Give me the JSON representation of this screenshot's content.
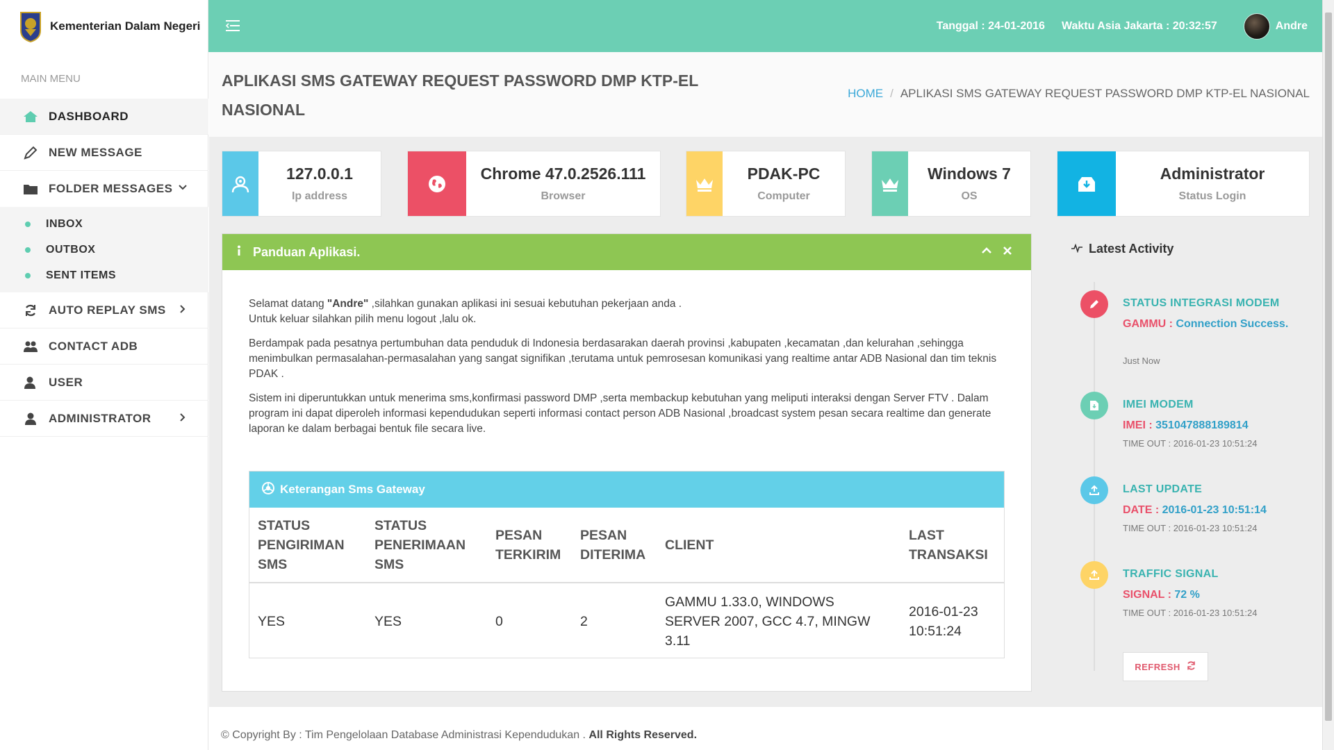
{
  "brand": {
    "name": "Kementerian Dalam Negeri"
  },
  "sidebar": {
    "caption": "MAIN MENU",
    "items": [
      {
        "label": "DASHBOARD",
        "icon": "home-icon"
      },
      {
        "label": "NEW MESSAGE",
        "icon": "pencil-icon"
      },
      {
        "label": "FOLDER MESSAGES",
        "icon": "folder-icon"
      },
      {
        "label": "AUTO REPLAY SMS",
        "icon": "refresh-icon"
      },
      {
        "label": "CONTACT ADB",
        "icon": "users-icon"
      },
      {
        "label": "USER",
        "icon": "user-icon"
      },
      {
        "label": "ADMINISTRATOR",
        "icon": "user-icon"
      }
    ],
    "sub_items": [
      {
        "label": "INBOX"
      },
      {
        "label": "OUTBOX"
      },
      {
        "label": "SENT ITEMS"
      }
    ]
  },
  "topbar": {
    "date": "Tanggal : 24-01-2016",
    "time": "Waktu Asia Jakarta : 20:32:57",
    "user": "Andre"
  },
  "page": {
    "title": "APLIKASI SMS GATEWAY REQUEST PASSWORD DMP KTP-EL NASIONAL",
    "breadcrumb_home": "HOME",
    "breadcrumb_current": "APLIKASI SMS GATEWAY REQUEST PASSWORD DMP KTP-EL NASIONAL"
  },
  "stats": [
    {
      "value": "127.0.0.1",
      "label": "Ip address",
      "color": "#5bc8e8",
      "icon": "user-search-icon"
    },
    {
      "value": "Chrome 47.0.2526.111",
      "label": "Browser",
      "color": "#ec5066",
      "icon": "globe-icon"
    },
    {
      "value": "PDAK-PC",
      "label": "Computer",
      "color": "#fed466",
      "icon": "crown-icon"
    },
    {
      "value": "Windows 7",
      "label": "OS",
      "color": "#6ccfb4",
      "icon": "crown-icon"
    },
    {
      "value": "Administrator",
      "label": "Status Login",
      "color": "#12b3e3",
      "icon": "inbox-download-icon"
    }
  ],
  "guide": {
    "title": "Panduan Aplikasi.",
    "p1a": "Selamat datang ",
    "p1_user": "\"Andre\"",
    "p1b": " ,silahkan gunakan aplikasi ini sesuai kebutuhan pekerjaan anda .",
    "p1c": "Untuk keluar silahkan pilih menu logout ,lalu ok.",
    "p2": "Berdampak pada pesatnya pertumbuhan data penduduk di Indonesia berdasarakan daerah provinsi ,kabupaten ,kecamatan ,dan kelurahan ,sehingga menimbulkan permasalahan-permasalahan yang sangat signifikan ,terutama untuk pemrosesan komunikasi yang realtime antar ADB Nasional dan tim teknis PDAK .",
    "p3": "Sistem ini diperuntukkan untuk menerima sms,konfirmasi password DMP ,serta membackup kebutuhan yang meliputi interaksi dengan Server FTV . Dalam program ini dapat diperoleh informasi kependudukan seperti informasi contact person ADB Nasional ,broadcast system pesan secara realtime dan generate laporan ke dalam berbagai bentuk file secara live."
  },
  "gateway": {
    "title": "Keterangan Sms Gateway",
    "headers": [
      "STATUS PENGIRIMAN SMS",
      "STATUS PENERIMAAN SMS",
      "PESAN TERKIRIM",
      "PESAN DITERIMA",
      "CLIENT",
      "LAST TRANSAKSI"
    ],
    "row": [
      "YES",
      "YES",
      "0",
      "2",
      "GAMMU 1.33.0, WINDOWS SERVER 2007, GCC 4.7, MINGW 3.11",
      "2016-01-23 10:51:24"
    ]
  },
  "activity": {
    "title": "Latest Activity",
    "items": [
      {
        "title": "STATUS INTEGRASI MODEM",
        "key": "GAMMU :",
        "value": "Connection Success.",
        "time": "Just Now",
        "color": "#ec5066",
        "icon": "pencil-icon"
      },
      {
        "title": "IMEI MODEM",
        "key": "IMEI :",
        "value": "351047888189814",
        "time": "TIME OUT : 2016-01-23 10:51:24",
        "color": "#6ccfb4",
        "icon": "file-icon"
      },
      {
        "title": "LAST UPDATE",
        "key": "DATE :",
        "value": "2016-01-23 10:51:14",
        "time": "TIME OUT : 2016-01-23 10:51:24",
        "color": "#5bc8e8",
        "icon": "upload-icon"
      },
      {
        "title": "TRAFFIC SIGNAL",
        "key": "SIGNAL :",
        "value": "72 %",
        "time": "TIME OUT : 2016-01-23 10:51:24",
        "color": "#fed466",
        "icon": "upload-icon"
      }
    ],
    "refresh_label": "REFRESH"
  },
  "footer": {
    "text": "© Copyright By : Tim Pengelolaan Database Administrasi Kependudukan . ",
    "bold": "All Rights Reserved."
  }
}
